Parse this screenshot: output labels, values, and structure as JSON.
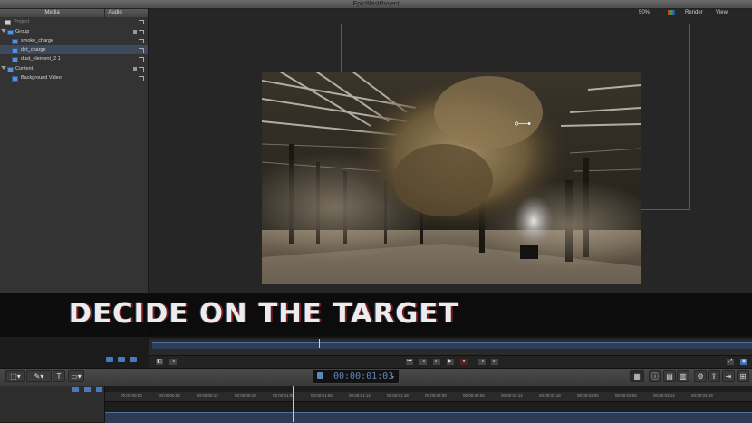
{
  "window": {
    "title": "EpicBlastProject"
  },
  "left_panel": {
    "tabs": [
      "Media",
      "Audio"
    ],
    "layers": [
      {
        "label": "Project",
        "level": 0,
        "selected": false
      },
      {
        "label": "Group",
        "level": 0,
        "selected": false
      },
      {
        "label": "smoke_charge",
        "level": 1,
        "selected": false
      },
      {
        "label": "dirt_charge",
        "level": 1,
        "selected": true
      },
      {
        "label": "dust_element_2 1",
        "level": 1,
        "selected": false
      },
      {
        "label": "Content",
        "level": 0,
        "selected": false
      },
      {
        "label": "Background Video",
        "level": 1,
        "selected": false
      }
    ]
  },
  "canvas_menus": {
    "zoom": "50%",
    "render": "Render",
    "view": "View"
  },
  "caption": {
    "text": "DECIDE ON THE TARGET"
  },
  "timecode": {
    "value": "00:00:01:03"
  },
  "ruler_ticks": [
    "00:00:00:00",
    "00:00:00:06",
    "00:00:00:12",
    "00:00:00:18",
    "00:00:01:00",
    "00:00:01:06",
    "00:00:01:12",
    "00:00:01:18",
    "00:00:02:00",
    "00:00:02:06",
    "00:00:02:12",
    "00:00:02:18",
    "00:00:03:00",
    "00:00:03:06",
    "00:00:03:12",
    "00:00:03:18"
  ],
  "colors": {
    "accent": "#5f86b8",
    "selection": "#3e4a5c",
    "track": "#2c3b52"
  }
}
